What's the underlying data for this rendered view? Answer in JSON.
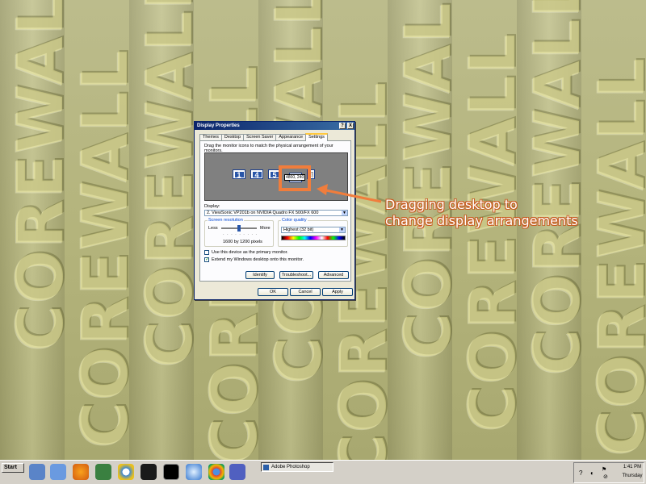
{
  "wallpaper": {
    "text": "COREWALL",
    "colors": {
      "base": "#b8b880",
      "text": "#e6e196"
    }
  },
  "dialog": {
    "title": "Display Properties",
    "help_btn": "?",
    "close_btn": "X",
    "tabs": [
      "Themes",
      "Desktop",
      "Screen Saver",
      "Appearance",
      "Settings"
    ],
    "active_tab": "Settings",
    "instructions": "Drag the monitor icons to match the physical arrangement of your monitors.",
    "monitors": [
      {
        "label": "1",
        "selected": false
      },
      {
        "label": "4",
        "selected": false
      },
      {
        "label": "5",
        "selected": false
      },
      {
        "label": "2",
        "selected": true
      },
      {
        "label": "3",
        "selected": false
      }
    ],
    "coordinate_tooltip": "4800, 240",
    "display_label": "Display:",
    "display_value": "2. ViewSonic VP201b on NVIDIA Quadro FX 500/FX 600",
    "screen_resolution": {
      "title": "Screen resolution",
      "less": "Less",
      "more": "More",
      "value": "1600 by 1200 pixels"
    },
    "color_quality": {
      "title": "Color quality",
      "value": "Highest (32 bit)"
    },
    "checkboxes": [
      {
        "label": "Use this device as the primary monitor.",
        "checked": false
      },
      {
        "label": "Extend my Windows desktop onto this monitor.",
        "checked": true
      }
    ],
    "panel_buttons": [
      "Identify",
      "Troubleshoot...",
      "Advanced"
    ],
    "bottom_buttons": [
      "OK",
      "Cancel",
      "Apply"
    ]
  },
  "annotation": {
    "line1": "Dragging desktop to",
    "line2": "change display arrangements",
    "color": "#f07d3c"
  },
  "taskbar": {
    "start_label": "Start",
    "task_label": "Adobe Photoshop",
    "clock_time": "1:41 PM",
    "clock_day": "Thursday",
    "quick_launch_icons": [
      "explorer-icon",
      "computer-icon",
      "firefox-icon",
      "tools-icon",
      "chrome-ring-icon",
      "video-icon",
      "cmd-icon",
      "safari-icon",
      "chrome-icon",
      "app-icon"
    ]
  }
}
